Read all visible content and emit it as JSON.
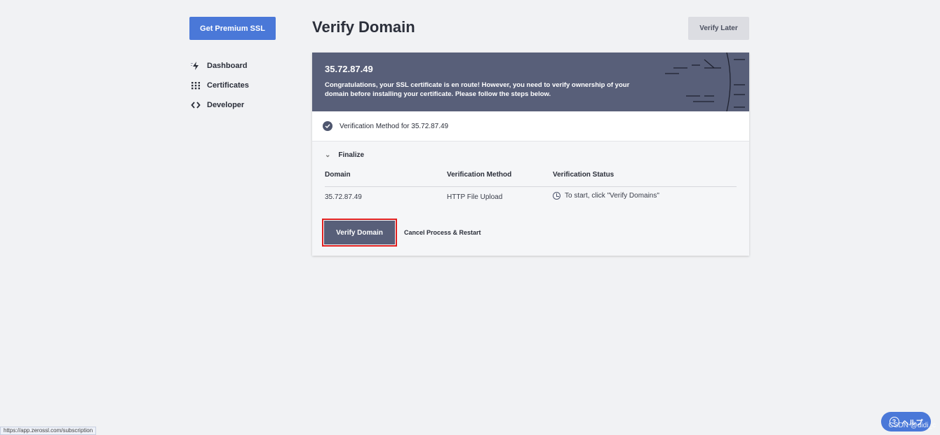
{
  "sidebar": {
    "premium_label": "Get Premium SSL",
    "items": [
      {
        "label": "Dashboard",
        "icon": "bolt-icon"
      },
      {
        "label": "Certificates",
        "icon": "grid-dots-icon"
      },
      {
        "label": "Developer",
        "icon": "code-brackets-icon"
      }
    ]
  },
  "header": {
    "title": "Verify Domain",
    "verify_later_label": "Verify Later"
  },
  "banner": {
    "domain": "35.72.87.49",
    "message": "Congratulations, your SSL certificate is en route! However, you need to verify ownership of your domain before installing your certificate. Please follow the steps below."
  },
  "method": {
    "label": "Verification Method for 35.72.87.49"
  },
  "finalize": {
    "label": "Finalize",
    "columns": [
      "Domain",
      "Verification Method",
      "Verification Status"
    ],
    "rows": [
      {
        "domain": "35.72.87.49",
        "method": "HTTP File Upload",
        "status": "To start, click \"Verify Domains\""
      }
    ],
    "verify_label": "Verify Domain",
    "cancel_label": "Cancel Process & Restart"
  },
  "footer": {
    "status_url": "https://app.zerossl.com/subscription",
    "help_label": "ヘルプ",
    "watermark": "CSDN @didi_c"
  },
  "colors": {
    "accent": "#4a78d8",
    "banner": "#585f79",
    "highlight": "#e02020"
  }
}
